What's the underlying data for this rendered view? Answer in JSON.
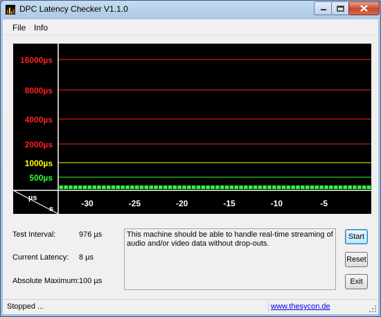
{
  "window": {
    "title": "DPC Latency Checker V1.1.0"
  },
  "menu": [
    "File",
    "Info"
  ],
  "chart_data": {
    "type": "bar",
    "y_labels": [
      "16000µs",
      "8000µs",
      "4000µs",
      "2000µs",
      "1000µs",
      "500µs"
    ],
    "y_label_colors": [
      "#ff2020",
      "#ff2020",
      "#ff2020",
      "#ff2020",
      "#ffff00",
      "#33ff33"
    ],
    "x_ticks": [
      -30,
      -25,
      -20,
      -15,
      -10,
      -5
    ],
    "x_range": [
      -33,
      0
    ],
    "x_unit": "s",
    "y_unit": "µs",
    "series": [
      {
        "values": [
          8,
          8,
          8,
          8,
          8,
          8,
          8,
          8,
          8,
          8,
          8,
          8,
          8,
          8,
          8,
          8,
          8,
          8,
          8,
          8,
          8,
          8,
          8,
          8,
          8,
          8,
          8,
          8,
          8,
          8,
          8,
          8,
          8,
          8,
          8,
          8,
          8,
          8,
          8,
          8,
          8,
          8,
          8,
          8,
          8,
          8,
          8,
          8,
          8,
          8,
          8,
          8,
          8,
          8,
          8,
          8,
          8,
          8,
          8,
          8,
          8,
          8,
          8,
          8,
          8,
          8
        ]
      }
    ],
    "background": "#000000",
    "bar_color": "#33ff33"
  },
  "info": {
    "test_interval_label": "Test Interval:",
    "test_interval_value": "976 µs",
    "current_latency_label": "Current Latency:",
    "current_latency_value": "8 µs",
    "absolute_max_label": "Absolute Maximum:",
    "absolute_max_value": "100 µs"
  },
  "message": "This machine should be able to handle real-time streaming of audio and/or video data without drop-outs.",
  "buttons": {
    "start": "Start",
    "reset": "Reset",
    "exit": "Exit"
  },
  "status": {
    "text": "Stopped ...",
    "link": "www.thesycon.de"
  }
}
